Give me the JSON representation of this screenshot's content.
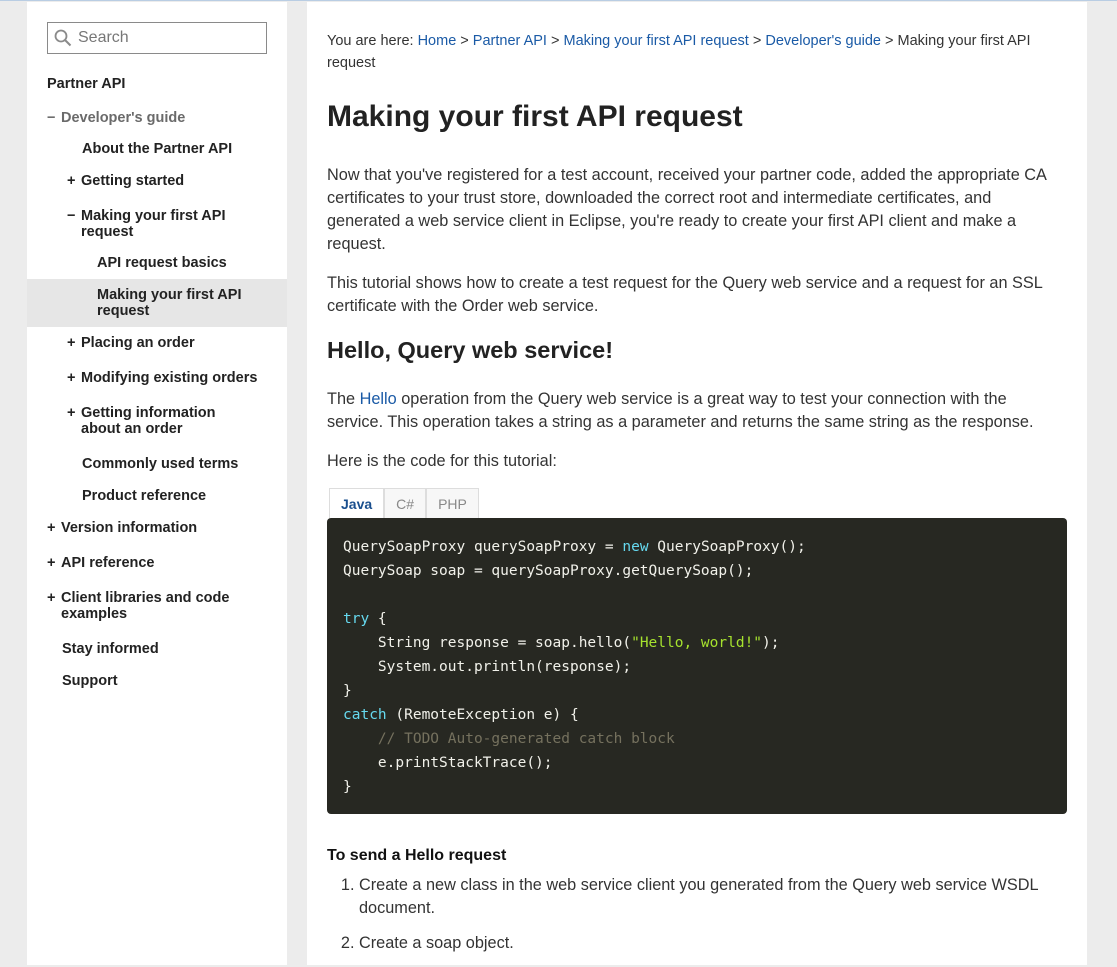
{
  "search": {
    "placeholder": "Search"
  },
  "nav": [
    {
      "label": "Partner API",
      "toggle": ""
    },
    {
      "label": "Developer's guide",
      "toggle": "−"
    },
    {
      "label": "About the Partner API",
      "toggle": ""
    },
    {
      "label": "Getting started",
      "toggle": "+"
    },
    {
      "label1": "Making your first API",
      "label2": "request",
      "toggle": "−"
    },
    {
      "label": "API request basics",
      "toggle": ""
    },
    {
      "label1": "Making your first API",
      "label2": "request",
      "toggle": ""
    },
    {
      "label": "Placing an order",
      "toggle": "+"
    },
    {
      "label": "Modifying existing orders",
      "toggle": "+"
    },
    {
      "label1": "Getting information",
      "label2": "about an order",
      "toggle": "+"
    },
    {
      "label": "Commonly used terms",
      "toggle": ""
    },
    {
      "label": "Product reference",
      "toggle": ""
    },
    {
      "label": "Version information",
      "toggle": "+"
    },
    {
      "label": "API reference",
      "toggle": "+"
    },
    {
      "label1": "Client libraries and code",
      "label2": "examples",
      "toggle": "+"
    },
    {
      "label": "Stay informed",
      "toggle": ""
    },
    {
      "label": "Support",
      "toggle": ""
    }
  ],
  "breadcrumb": {
    "prefix": "You are here:",
    "links": [
      "Home",
      "Partner API",
      "Making your first API request",
      "Developer's guide"
    ],
    "sep": ">",
    "current": "Making your first API request"
  },
  "page": {
    "title": "Making your first API request",
    "intro": "Now that you've registered for a test account, received your partner code, added the appropriate CA certificates to your trust store, downloaded the correct root and intermediate certificates, and generated a web service client in Eclipse, you're ready to create your first API client and make a request.",
    "tutorial": "This tutorial shows how to create a test request for the Query web service and a request for an SSL certificate with the Order web service.",
    "section_title": "Hello, Query web service!",
    "hello_pre": "The ",
    "hello_link": "Hello",
    "hello_post": " operation from the Query web service is a great way to test your connection with the service. This operation takes a string as a parameter and returns the same string as the response.",
    "code_intro": "Here is the code for this tutorial:",
    "subhead": "To send a Hello request",
    "steps": [
      "Create a new class in the web service client you generated from the Query web service WSDL document.",
      "Create a soap object."
    ]
  },
  "tabs": [
    "Java",
    "C#",
    "PHP"
  ],
  "code": {
    "l1a": "QuerySoapProxy querySoapProxy = ",
    "l1kw": "new",
    "l1b": " QuerySoapProxy();",
    "l2": "QuerySoap soap = querySoapProxy.getQuerySoap();",
    "l4kw": "try",
    "l4b": " {",
    "l5a": "    String response = soap.hello(",
    "l5str": "\"Hello, world!\"",
    "l5b": ");",
    "l6": "    System.out.println(response);",
    "l7": "}",
    "l8kw": "catch",
    "l8b": " (RemoteException e) {",
    "l9": "    // TODO Auto-generated catch block",
    "l10": "    e.printStackTrace();",
    "l11": "}"
  },
  "colors": {
    "link": "#1a5aa6",
    "code_bg": "#272822",
    "keyword": "#66d9ef",
    "string": "#a6e22e",
    "comment": "#75715e",
    "selected_nav": "#e6e6e6"
  }
}
